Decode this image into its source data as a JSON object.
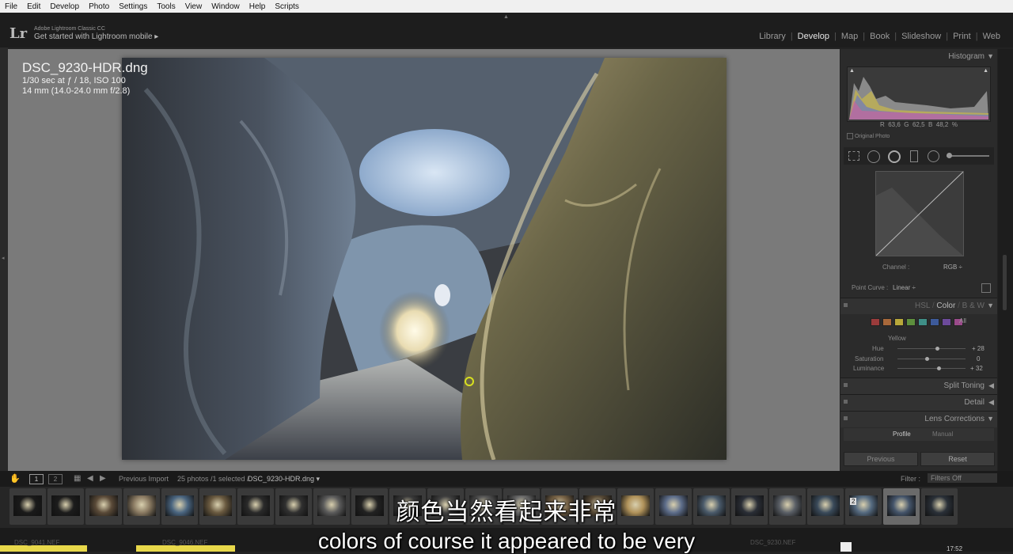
{
  "menu": [
    "File",
    "Edit",
    "Develop",
    "Photo",
    "Settings",
    "Tools",
    "View",
    "Window",
    "Help",
    "Scripts"
  ],
  "identity": {
    "logo": "Lr",
    "app_name": "Adobe Lightroom Classic CC",
    "mobile_link": "Get started with Lightroom mobile ▸"
  },
  "modules": [
    "Library",
    "Develop",
    "Map",
    "Book",
    "Slideshow",
    "Print",
    "Web"
  ],
  "active_module": "Develop",
  "photo_info": {
    "filename": "DSC_9230-HDR.dng",
    "exposure": "1/30 sec at ƒ / 18, ISO 100",
    "lens": "14 mm (14.0-24.0 mm f/2.8)"
  },
  "histogram": {
    "title": "Histogram",
    "r_label": "R",
    "r_value": "63,6",
    "g_label": "G",
    "g_value": "62,5",
    "b_label": "B",
    "b_value": "48,2",
    "unit": "%",
    "original_photo": "Original Photo"
  },
  "tone_curve": {
    "channel_label": "Channel :",
    "channel_value": "RGB ÷",
    "point_curve_label": "Point Curve :",
    "point_curve_value": "Linear ÷"
  },
  "hsl": {
    "tab_hsl": "HSL",
    "tab_color": "Color",
    "tab_bw": "B & W",
    "all_label": "All",
    "swatches": [
      "#9a3b3b",
      "#a8683a",
      "#b8a83a",
      "#5d8f3d",
      "#3f8f87",
      "#3d5a9a",
      "#6c4a9a",
      "#9a4a8a"
    ],
    "selected_color": "Yellow",
    "hue_label": "Hue",
    "hue_value": "+ 28",
    "sat_label": "Saturation",
    "sat_value": "0",
    "lum_label": "Luminance",
    "lum_value": "+ 32"
  },
  "panels": {
    "split_toning": "Split Toning",
    "detail": "Detail",
    "lens_corrections": "Lens Corrections",
    "profile_tab": "Profile",
    "manual_tab": "Manual",
    "previous": "Previous",
    "reset": "Reset"
  },
  "toolbar": {
    "screen1": "1",
    "screen2": "2",
    "source": "Previous Import",
    "count": "25 photos /1 selected /",
    "path": "DSC_9230-HDR.dng ▾",
    "filter_label": "Filter :",
    "filter_value": "Filters Off"
  },
  "filmstrip": {
    "badge_2": "2"
  },
  "bottom_labels": [
    "DSC_9041.NEF",
    "DSC_9046.NEF",
    "DSC_9230.NEF"
  ],
  "clock": "17:52",
  "subtitles": {
    "chinese": "颜色当然看起来非常",
    "english": "colors of course it appeared to be very"
  }
}
